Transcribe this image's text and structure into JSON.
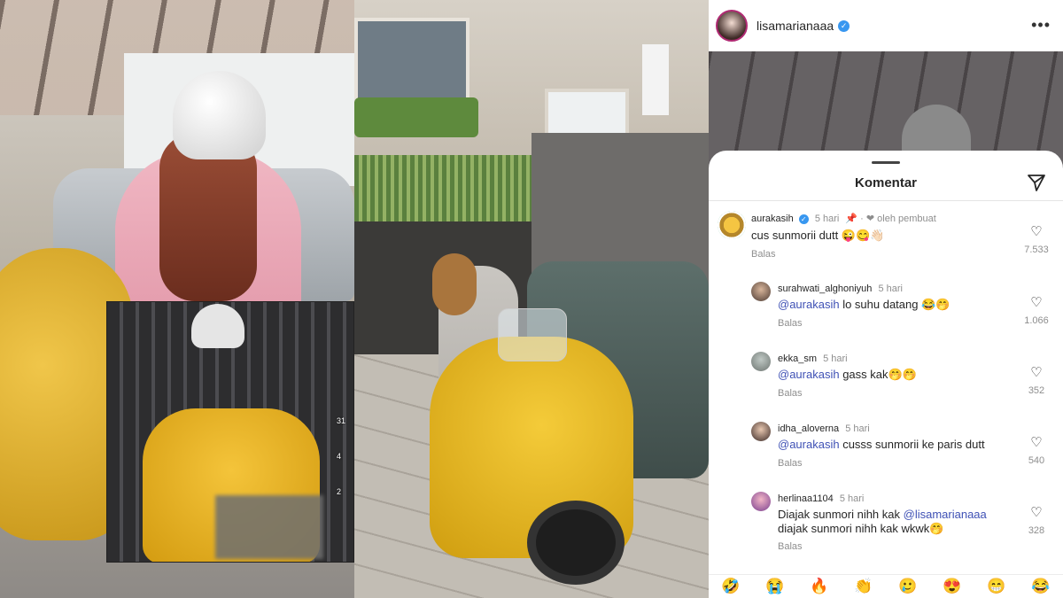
{
  "tiktok_side": [
    "31",
    "4",
    "2"
  ],
  "instagram": {
    "username": "lisamarianaaa",
    "sheet_title": "Komentar",
    "comments": [
      {
        "user": "aurakasih",
        "verified": true,
        "time": "5 hari",
        "pinned_note": "📌 · ❤ oleh pembuat",
        "text_parts": [
          {
            "t": "cus sunmorii dutt 😜😋👋🏻",
            "mention": false
          }
        ],
        "reply": "Balas",
        "likes": "7.533"
      },
      {
        "user": "surahwati_alghoniyuh",
        "time": "5 hari",
        "text_parts": [
          {
            "t": "@aurakasih",
            "mention": true
          },
          {
            "t": " lo suhu datang 😂🤭",
            "mention": false
          }
        ],
        "reply": "Balas",
        "likes": "1.066"
      },
      {
        "user": "ekka_sm",
        "time": "5 hari",
        "text_parts": [
          {
            "t": "@aurakasih",
            "mention": true
          },
          {
            "t": " gass kak🤭🤭",
            "mention": false
          }
        ],
        "reply": "Balas",
        "likes": "352"
      },
      {
        "user": "idha_aloverna",
        "time": "5 hari",
        "text_parts": [
          {
            "t": "@aurakasih",
            "mention": true
          },
          {
            "t": " cusss sunmorii ke paris dutt",
            "mention": false
          }
        ],
        "reply": "Balas",
        "likes": "540"
      },
      {
        "user": "herlinaa1104",
        "time": "5 hari",
        "text_line1": "Diajak sunmori nihh kak ",
        "text_line1_mention": "@lisamarianaaa",
        "text_line2": "diajak sunmori nihh kak wkwk🤭",
        "reply": "Balas",
        "likes": "328"
      }
    ],
    "emoji_bar": [
      "🤣",
      "😭",
      "🔥",
      "👏",
      "🥲",
      "😍",
      "😁",
      "😂"
    ],
    "colors": {
      "mention": "#3f51b5",
      "verified": "#3897f0"
    }
  }
}
